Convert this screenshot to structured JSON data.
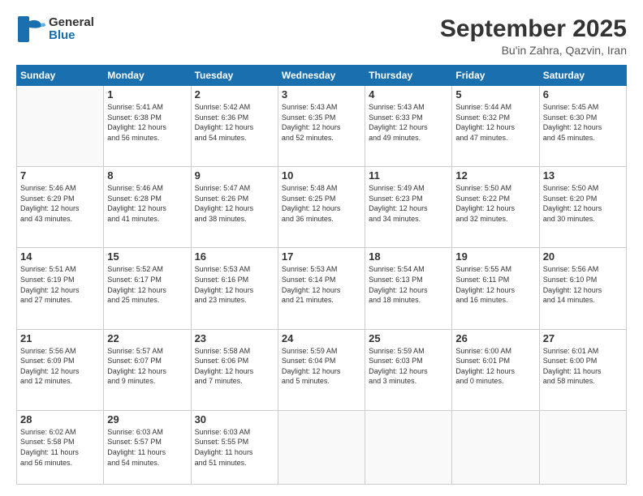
{
  "header": {
    "logo_line1": "General",
    "logo_line2": "Blue",
    "title": "September 2025",
    "subtitle": "Bu'in Zahra, Qazvin, Iran"
  },
  "weekdays": [
    "Sunday",
    "Monday",
    "Tuesday",
    "Wednesday",
    "Thursday",
    "Friday",
    "Saturday"
  ],
  "weeks": [
    [
      {
        "day": "",
        "info": ""
      },
      {
        "day": "1",
        "info": "Sunrise: 5:41 AM\nSunset: 6:38 PM\nDaylight: 12 hours\nand 56 minutes."
      },
      {
        "day": "2",
        "info": "Sunrise: 5:42 AM\nSunset: 6:36 PM\nDaylight: 12 hours\nand 54 minutes."
      },
      {
        "day": "3",
        "info": "Sunrise: 5:43 AM\nSunset: 6:35 PM\nDaylight: 12 hours\nand 52 minutes."
      },
      {
        "day": "4",
        "info": "Sunrise: 5:43 AM\nSunset: 6:33 PM\nDaylight: 12 hours\nand 49 minutes."
      },
      {
        "day": "5",
        "info": "Sunrise: 5:44 AM\nSunset: 6:32 PM\nDaylight: 12 hours\nand 47 minutes."
      },
      {
        "day": "6",
        "info": "Sunrise: 5:45 AM\nSunset: 6:30 PM\nDaylight: 12 hours\nand 45 minutes."
      }
    ],
    [
      {
        "day": "7",
        "info": "Sunrise: 5:46 AM\nSunset: 6:29 PM\nDaylight: 12 hours\nand 43 minutes."
      },
      {
        "day": "8",
        "info": "Sunrise: 5:46 AM\nSunset: 6:28 PM\nDaylight: 12 hours\nand 41 minutes."
      },
      {
        "day": "9",
        "info": "Sunrise: 5:47 AM\nSunset: 6:26 PM\nDaylight: 12 hours\nand 38 minutes."
      },
      {
        "day": "10",
        "info": "Sunrise: 5:48 AM\nSunset: 6:25 PM\nDaylight: 12 hours\nand 36 minutes."
      },
      {
        "day": "11",
        "info": "Sunrise: 5:49 AM\nSunset: 6:23 PM\nDaylight: 12 hours\nand 34 minutes."
      },
      {
        "day": "12",
        "info": "Sunrise: 5:50 AM\nSunset: 6:22 PM\nDaylight: 12 hours\nand 32 minutes."
      },
      {
        "day": "13",
        "info": "Sunrise: 5:50 AM\nSunset: 6:20 PM\nDaylight: 12 hours\nand 30 minutes."
      }
    ],
    [
      {
        "day": "14",
        "info": "Sunrise: 5:51 AM\nSunset: 6:19 PM\nDaylight: 12 hours\nand 27 minutes."
      },
      {
        "day": "15",
        "info": "Sunrise: 5:52 AM\nSunset: 6:17 PM\nDaylight: 12 hours\nand 25 minutes."
      },
      {
        "day": "16",
        "info": "Sunrise: 5:53 AM\nSunset: 6:16 PM\nDaylight: 12 hours\nand 23 minutes."
      },
      {
        "day": "17",
        "info": "Sunrise: 5:53 AM\nSunset: 6:14 PM\nDaylight: 12 hours\nand 21 minutes."
      },
      {
        "day": "18",
        "info": "Sunrise: 5:54 AM\nSunset: 6:13 PM\nDaylight: 12 hours\nand 18 minutes."
      },
      {
        "day": "19",
        "info": "Sunrise: 5:55 AM\nSunset: 6:11 PM\nDaylight: 12 hours\nand 16 minutes."
      },
      {
        "day": "20",
        "info": "Sunrise: 5:56 AM\nSunset: 6:10 PM\nDaylight: 12 hours\nand 14 minutes."
      }
    ],
    [
      {
        "day": "21",
        "info": "Sunrise: 5:56 AM\nSunset: 6:09 PM\nDaylight: 12 hours\nand 12 minutes."
      },
      {
        "day": "22",
        "info": "Sunrise: 5:57 AM\nSunset: 6:07 PM\nDaylight: 12 hours\nand 9 minutes."
      },
      {
        "day": "23",
        "info": "Sunrise: 5:58 AM\nSunset: 6:06 PM\nDaylight: 12 hours\nand 7 minutes."
      },
      {
        "day": "24",
        "info": "Sunrise: 5:59 AM\nSunset: 6:04 PM\nDaylight: 12 hours\nand 5 minutes."
      },
      {
        "day": "25",
        "info": "Sunrise: 5:59 AM\nSunset: 6:03 PM\nDaylight: 12 hours\nand 3 minutes."
      },
      {
        "day": "26",
        "info": "Sunrise: 6:00 AM\nSunset: 6:01 PM\nDaylight: 12 hours\nand 0 minutes."
      },
      {
        "day": "27",
        "info": "Sunrise: 6:01 AM\nSunset: 6:00 PM\nDaylight: 11 hours\nand 58 minutes."
      }
    ],
    [
      {
        "day": "28",
        "info": "Sunrise: 6:02 AM\nSunset: 5:58 PM\nDaylight: 11 hours\nand 56 minutes."
      },
      {
        "day": "29",
        "info": "Sunrise: 6:03 AM\nSunset: 5:57 PM\nDaylight: 11 hours\nand 54 minutes."
      },
      {
        "day": "30",
        "info": "Sunrise: 6:03 AM\nSunset: 5:55 PM\nDaylight: 11 hours\nand 51 minutes."
      },
      {
        "day": "",
        "info": ""
      },
      {
        "day": "",
        "info": ""
      },
      {
        "day": "",
        "info": ""
      },
      {
        "day": "",
        "info": ""
      }
    ]
  ]
}
